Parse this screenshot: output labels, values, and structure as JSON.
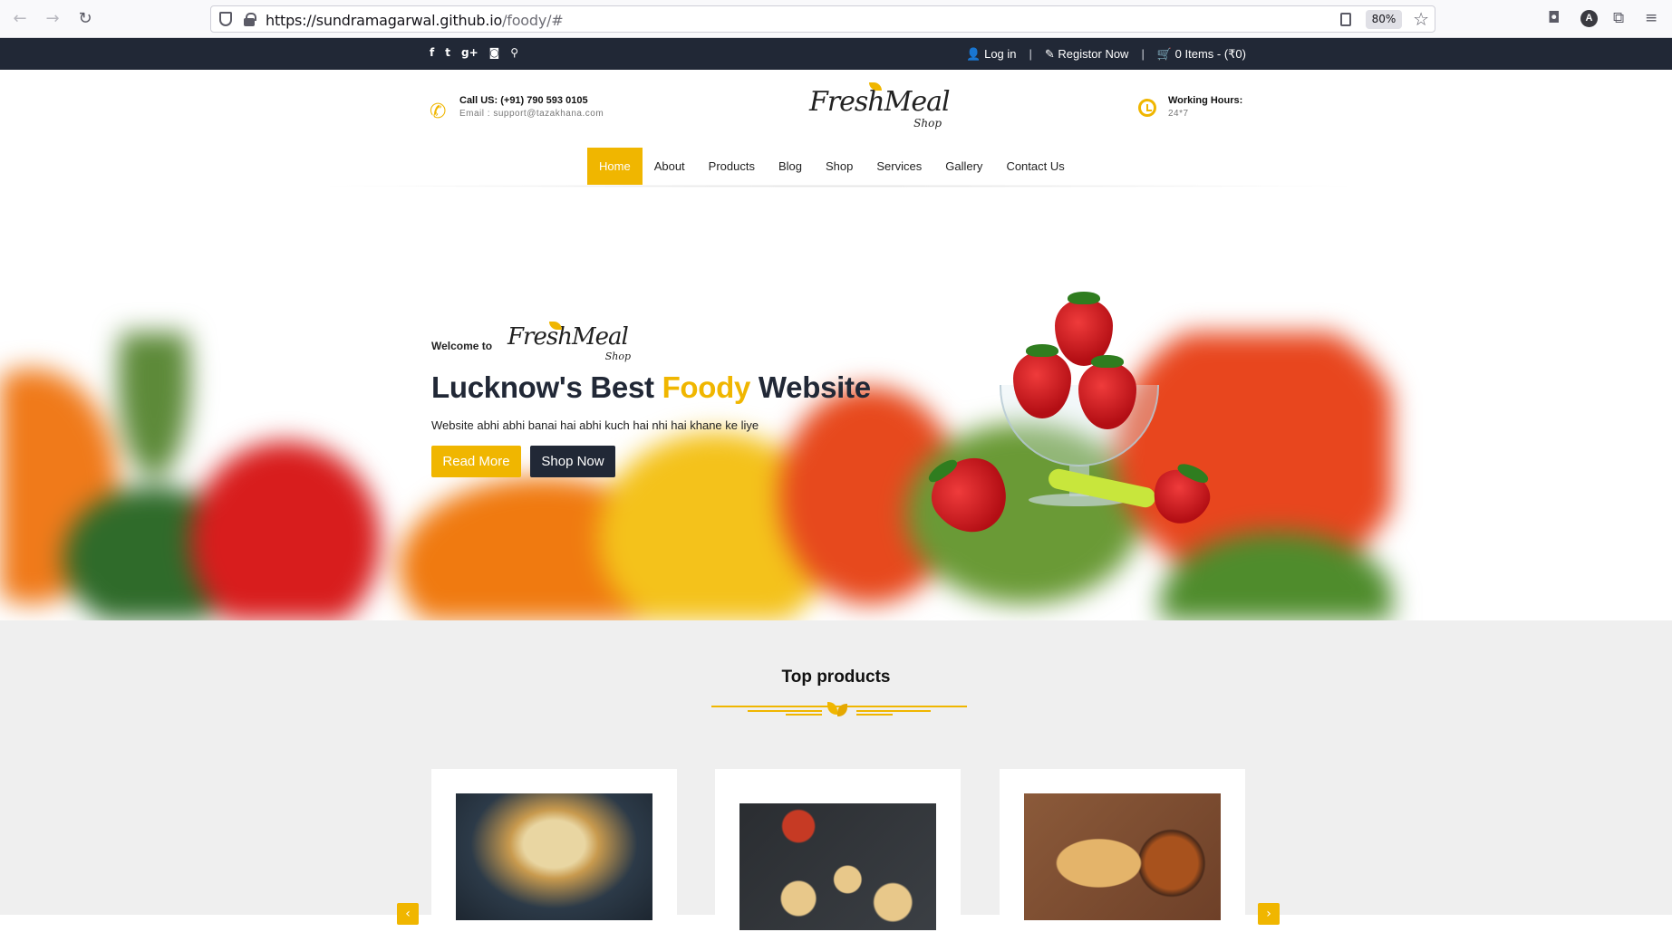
{
  "browser": {
    "url_host": "https://sundramagarwal.github.io",
    "url_path": "/foody/#",
    "zoom": "80%"
  },
  "topbar": {
    "social_icons": [
      "facebook-icon",
      "twitter-icon",
      "google-plus-icon",
      "instagram-icon",
      "search-icon"
    ],
    "login": "Log in",
    "register": "Registor Now",
    "cart": "0 Items - (₹0)",
    "separator": "|"
  },
  "header": {
    "call_title": "Call US: (+91) 790 593 0105",
    "email": "Email : support@tazakhana.com",
    "logo_main": "FreshMeal",
    "logo_shop": "Shop",
    "hours_title": "Working Hours:",
    "hours_value": "24*7"
  },
  "nav": {
    "items": [
      "Home",
      "About",
      "Products",
      "Blog",
      "Shop",
      "Services",
      "Gallery",
      "Contact Us"
    ],
    "active": "Home"
  },
  "hero": {
    "welcome": "Welcome to",
    "headline_pre": "Lucknow's Best ",
    "headline_accent": "Foody",
    "headline_post": " Website",
    "subtitle": "Website abhi abhi banai hai abhi kuch hai nhi hai khane ke liye",
    "read_more": "Read More",
    "shop_now": "Shop Now"
  },
  "products": {
    "title": "Top products",
    "arrow_prev": "‹",
    "arrow_next": "›"
  },
  "colors": {
    "accent": "#f0b600",
    "dark": "#212836"
  }
}
